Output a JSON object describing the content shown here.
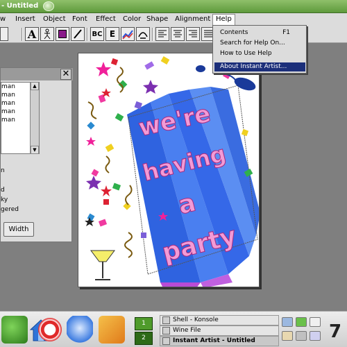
{
  "window": {
    "title": "- Untitled"
  },
  "menubar": {
    "items": [
      "w",
      "Insert",
      "Object",
      "Font",
      "Effect",
      "Color",
      "Shape",
      "Alignment",
      "Help"
    ]
  },
  "toolbar": {
    "buttons": [
      "text-A",
      "shape",
      "color-fill",
      "pen",
      "BC",
      "E-special",
      "chart",
      "curve",
      "align-left",
      "align-center",
      "align-right",
      "justify"
    ]
  },
  "help_menu": {
    "contents": "Contents",
    "contents_shortcut": "F1",
    "search": "Search for Help On...",
    "howto": "How to Use Help",
    "about": "About Instant Artist..."
  },
  "font_panel": {
    "fonts": [
      "man",
      "man",
      "man",
      "man",
      "man"
    ],
    "options": [
      "n",
      "d",
      "ky",
      "gered"
    ],
    "width_button": "Width"
  },
  "canvas": {
    "headline": [
      "we're",
      "having",
      "a",
      "party"
    ]
  },
  "taskbar": {
    "desktops": [
      "1",
      "2"
    ],
    "tasks": [
      "Shell - Konsole",
      "Wine File",
      "Instant Artist - Untitled"
    ],
    "clock": "7"
  },
  "colors": {
    "title_green": "#6fae4a",
    "highlight": "#1c2f7a",
    "stripe_blue": "#3f6ee8",
    "letter_pink": "#ef8fcf"
  }
}
